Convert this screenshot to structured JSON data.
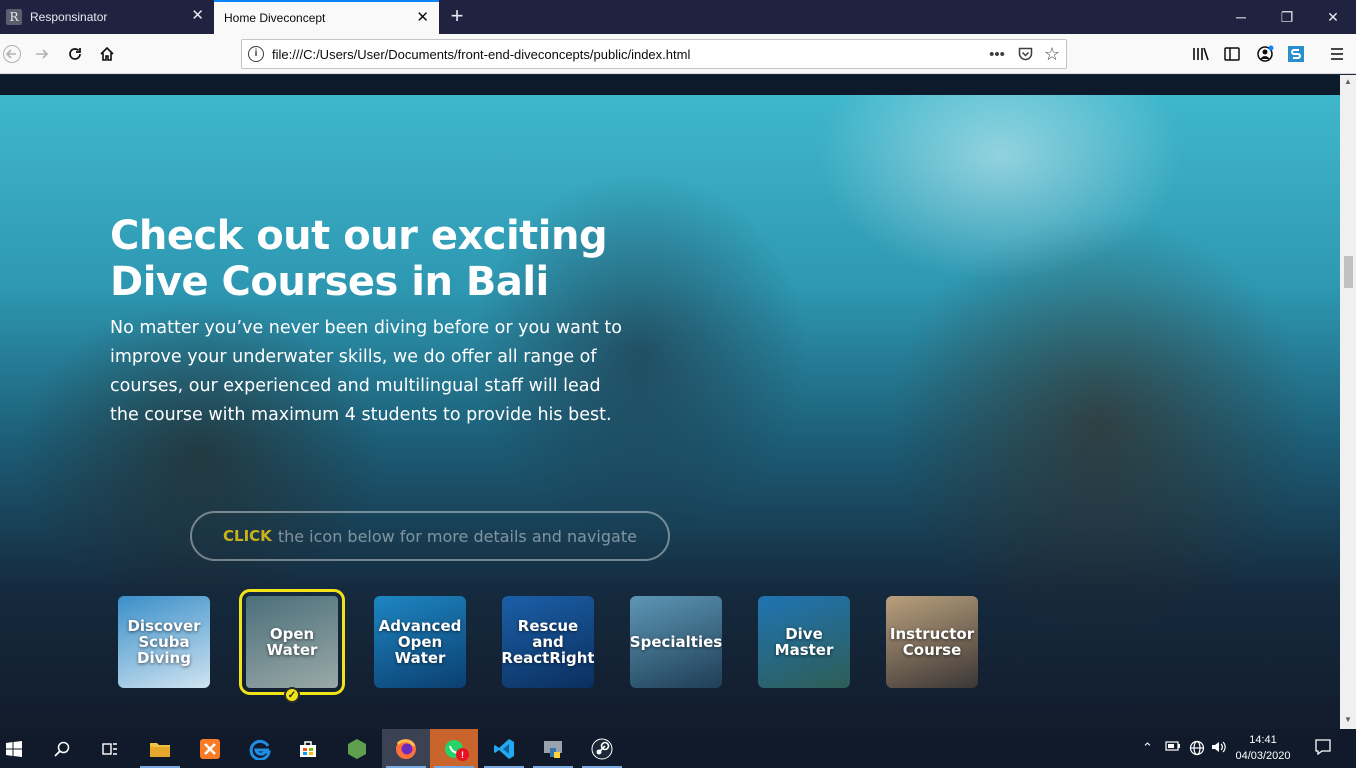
{
  "browser": {
    "tabs": [
      {
        "title": "Responsinator",
        "favicon_letter": "R",
        "active": false
      },
      {
        "title": "Home Diveconcept",
        "active": true
      }
    ],
    "new_tab_symbol": "+",
    "window_controls": {
      "minimize": "─",
      "restore": "❐",
      "close": "✕"
    },
    "url": "file:///C:/Users/User/Documents/front-end-diveconcepts/public/index.html",
    "url_actions": {
      "more": "•••",
      "pocket": "♡",
      "bookmark": "☆"
    }
  },
  "page": {
    "hero_title_line1": "Check out our exciting",
    "hero_title_line2": "Dive Courses in Bali",
    "hero_text": "No matter you’ve never been diving before or you want to improve your underwater skills, we do offer all range of courses, our experienced and multilingual staff will lead the course with maximum 4 students to provide his best.",
    "cta_highlight": "CLICK",
    "cta_text": "the icon below for more details and navigate",
    "courses": [
      {
        "label": "Discover Scuba Diving",
        "color_top": "#3a8fc9",
        "color_bottom": "#cfe3f0"
      },
      {
        "label": "Open Water",
        "color_top": "#4b6f7a",
        "color_bottom": "#9aa9a8",
        "selected": true
      },
      {
        "label": "Advanced Open Water",
        "color_top": "#1e86c2",
        "color_bottom": "#0b3f70"
      },
      {
        "label": "Rescue and ReactRight",
        "color_top": "#1b5fa8",
        "color_bottom": "#0b2f5e"
      },
      {
        "label": "Specialties",
        "color_top": "#5d97b6",
        "color_bottom": "#1f3e55"
      },
      {
        "label": "Dive Master",
        "color_top": "#1f74b3",
        "color_bottom": "#2e5d56"
      },
      {
        "label": "Instructor Course",
        "color_top": "#b9a07c",
        "color_bottom": "#3b3636"
      }
    ]
  },
  "taskbar": {
    "apps": [
      "start-icon",
      "search-icon",
      "task-view-icon",
      "file-explorer-icon",
      "xampp-icon",
      "edge-icon",
      "store-icon",
      "node-icon",
      "firefox-icon",
      "whatsapp-icon",
      "vscode-icon",
      "python-icon",
      "steam-icon"
    ],
    "whatsapp_badge": "!",
    "time": "14:41",
    "date": "04/03/2020"
  },
  "colors": {
    "accent_blue": "#0a84ff",
    "cta_yellow": "#c9b21a",
    "selected_outline": "#f2e218"
  }
}
